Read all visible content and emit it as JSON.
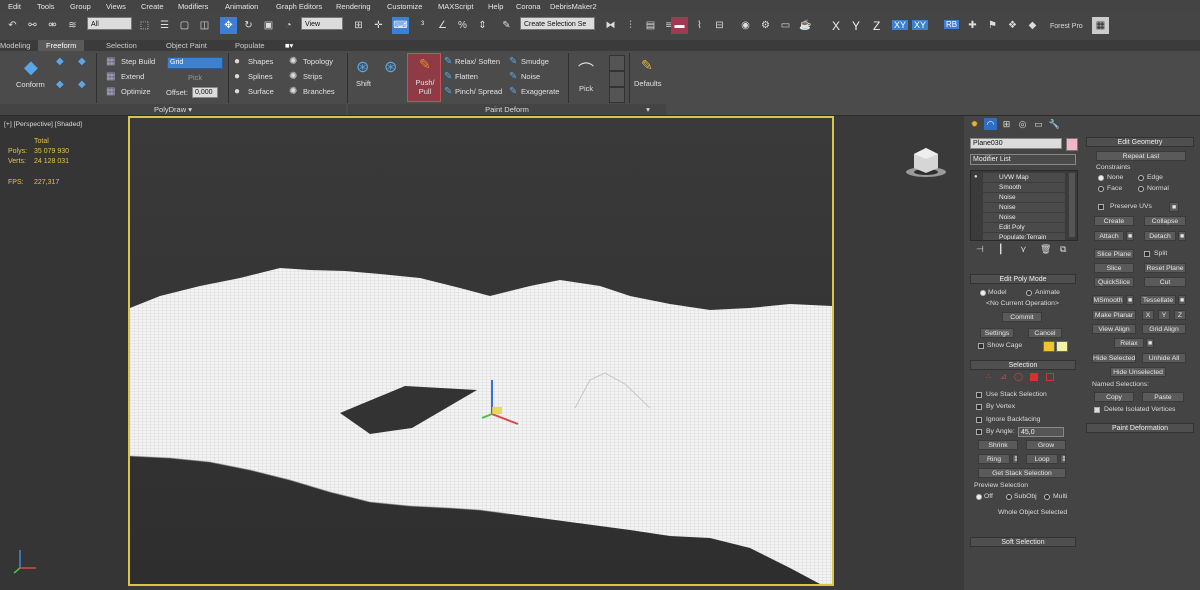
{
  "menu": [
    "Edit",
    "Tools",
    "Group",
    "Views",
    "Create",
    "Modifiers",
    "Animation",
    "Graph Editors",
    "Rendering",
    "Customize",
    "MAXScript",
    "Help",
    "Corona",
    "DebrisMaker2"
  ],
  "toolbar": {
    "selection_filter": "All",
    "ref_coord": "View",
    "named_selection": "Create Selection Se",
    "axes": [
      "X",
      "Y",
      "Z",
      "XY",
      "XY"
    ],
    "rb_label": "RB",
    "forest_label": "Forest Pro"
  },
  "ribbon_tabs": [
    "Modeling",
    "Freeform",
    "Selection",
    "Object Paint",
    "Populate"
  ],
  "ribbon": {
    "conform": "Conform",
    "step_build": "Step Build",
    "extend": "Extend",
    "optimize": "Optimize",
    "grid_value": "Grid",
    "pick": "Pick",
    "offset_label": "Offset:",
    "offset_value": "0,000",
    "shapes": "Shapes",
    "splines": "Splines",
    "surface": "Surface",
    "topology": "Topology",
    "strips": "Strips",
    "branches": "Branches",
    "polydraw_group": "PolyDraw",
    "shift": "Shift",
    "push_pull": "Push/ Pull",
    "relax_soften": "Relax/ Soften",
    "flatten": "Flatten",
    "pinch_spread": "Pinch/ Spread",
    "smudge": "Smudge",
    "noise": "Noise",
    "exaggerate": "Exaggerate",
    "paint_deform_group": "Paint Deform",
    "pick2": "Pick",
    "defaults": "Defaults"
  },
  "viewport": {
    "label": "[+] [Perspective] [Shaded]",
    "total_label": "Total",
    "polys_label": "Polys:",
    "polys_value": "35 079 930",
    "verts_label": "Verts:",
    "verts_value": "24 128 031",
    "fps_label": "FPS:",
    "fps_value": "227,317"
  },
  "panel": {
    "object_name": "Plane030",
    "modifier_list": "Modifier List",
    "stack": [
      "UVW Map",
      "Smooth",
      "Noise",
      "Noise",
      "Noise",
      "Edit Poly",
      "Populate:Terrain"
    ],
    "edit_poly_mode": {
      "title": "Edit Poly Mode",
      "model": "Model",
      "animate": "Animate",
      "no_op": "<No Current Operation>",
      "commit": "Commit",
      "settings": "Settings",
      "cancel": "Cancel",
      "show_cage": "Show Cage"
    },
    "selection": {
      "title": "Selection",
      "use_stack": "Use Stack Selection",
      "by_vertex": "By Vertex",
      "ignore_backfacing": "Ignore Backfacing",
      "by_angle": "By Angle:",
      "angle_value": "45,0",
      "shrink": "Shrink",
      "grow": "Grow",
      "ring": "Ring",
      "loop": "Loop",
      "get_stack": "Get Stack Selection",
      "preview_title": "Preview Selection",
      "off": "Off",
      "subobj": "SubObj",
      "multi": "Multi",
      "whole_object": "Whole Object Selected"
    },
    "soft_selection": "Soft Selection",
    "edit_geometry": {
      "title": "Edit Geometry",
      "repeat_last": "Repeat Last",
      "constraints": "Constraints",
      "none": "None",
      "edge": "Edge",
      "face": "Face",
      "normal": "Normal",
      "preserve_uvs": "Preserve UVs",
      "create": "Create",
      "collapse": "Collapse",
      "attach": "Attach",
      "detach": "Detach",
      "slice_plane": "Slice Plane",
      "split": "Split",
      "slice": "Slice",
      "reset_plane": "Reset Plane",
      "quickslice": "QuickSlice",
      "cut": "Cut",
      "msmooth": "MSmooth",
      "tessellate": "Tessellate",
      "make_planar": "Make Planar",
      "x": "X",
      "y": "Y",
      "z": "Z",
      "view_align": "View Align",
      "grid_align": "Grid Align",
      "relax": "Relax",
      "hide_selected": "Hide Selected",
      "unhide_all": "Unhide All",
      "hide_unselected": "Hide Unselected",
      "named_selections": "Named Selections:",
      "copy": "Copy",
      "paste": "Paste",
      "delete_isolated": "Delete Isolated Vertices"
    },
    "paint_deformation": "Paint Deformation"
  },
  "colors": {
    "accent": "#3f7fd1",
    "highlight": "#9c3b52",
    "viewport_border": "#d8c64a",
    "stats": "#e6c248"
  }
}
